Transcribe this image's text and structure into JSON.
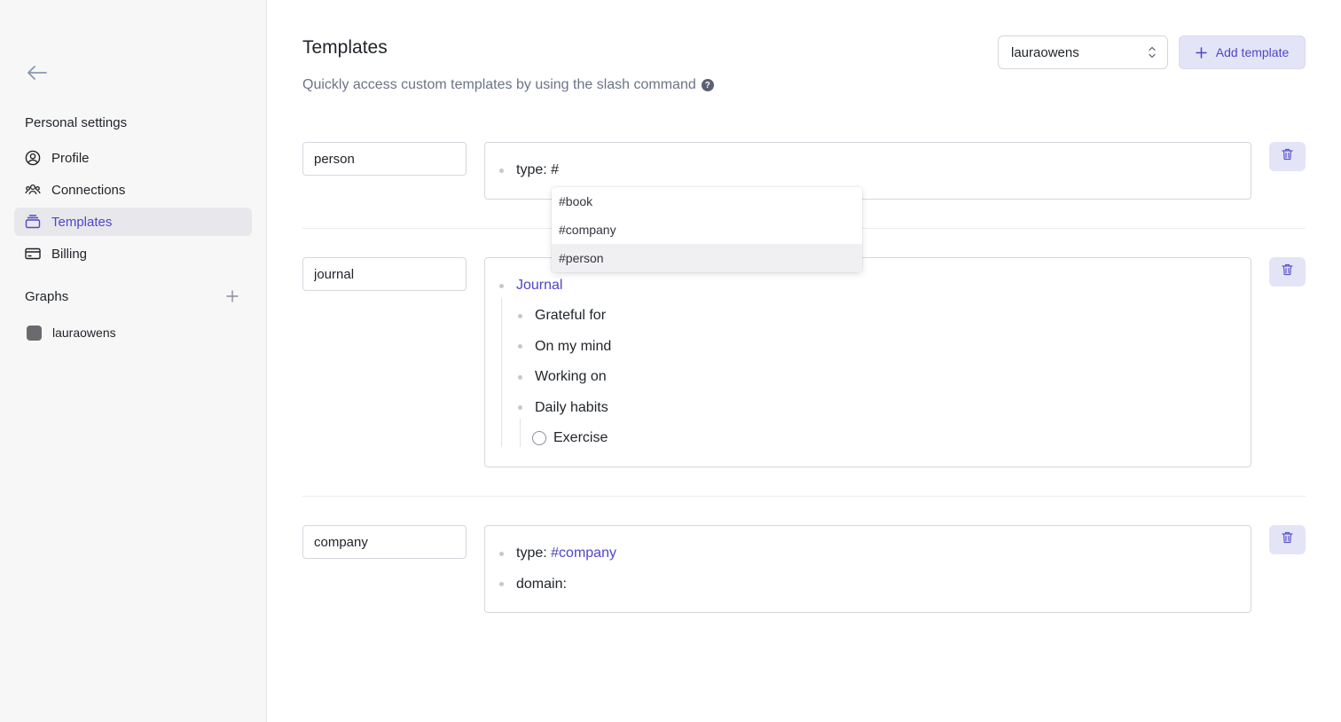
{
  "sidebar": {
    "personal_title": "Personal settings",
    "items": [
      {
        "label": "Profile",
        "icon": "user-circle-icon"
      },
      {
        "label": "Connections",
        "icon": "users-icon"
      },
      {
        "label": "Templates",
        "icon": "stack-icon",
        "active": true
      },
      {
        "label": "Billing",
        "icon": "credit-card-icon"
      }
    ],
    "graphs_title": "Graphs",
    "graphs": [
      {
        "label": "lauraowens"
      }
    ]
  },
  "header": {
    "title": "Templates",
    "subtitle": "Quickly access custom templates by using the slash command",
    "help": "?",
    "graph_select": "lauraowens",
    "add_label": "Add template"
  },
  "templates": [
    {
      "name": "person",
      "lines": [
        {
          "key": "type:",
          "value": " #"
        }
      ]
    },
    {
      "name": "journal",
      "lines": [
        {
          "text": "Journal"
        },
        {
          "text": "Grateful for"
        },
        {
          "text": "On my mind"
        },
        {
          "text": "Working on"
        },
        {
          "text": "Daily habits"
        },
        {
          "text": "Exercise"
        }
      ]
    },
    {
      "name": "company",
      "lines": [
        {
          "key": "type:",
          "value": "#company"
        },
        {
          "key": "domain:"
        }
      ]
    }
  ],
  "dropdown": {
    "options": [
      "#book",
      "#company",
      "#person"
    ],
    "selected": "#person"
  },
  "colors": {
    "accent": "#4f46c8",
    "accent_bg": "#e4e4f7",
    "sidebar_bg": "#f7f7f8"
  }
}
